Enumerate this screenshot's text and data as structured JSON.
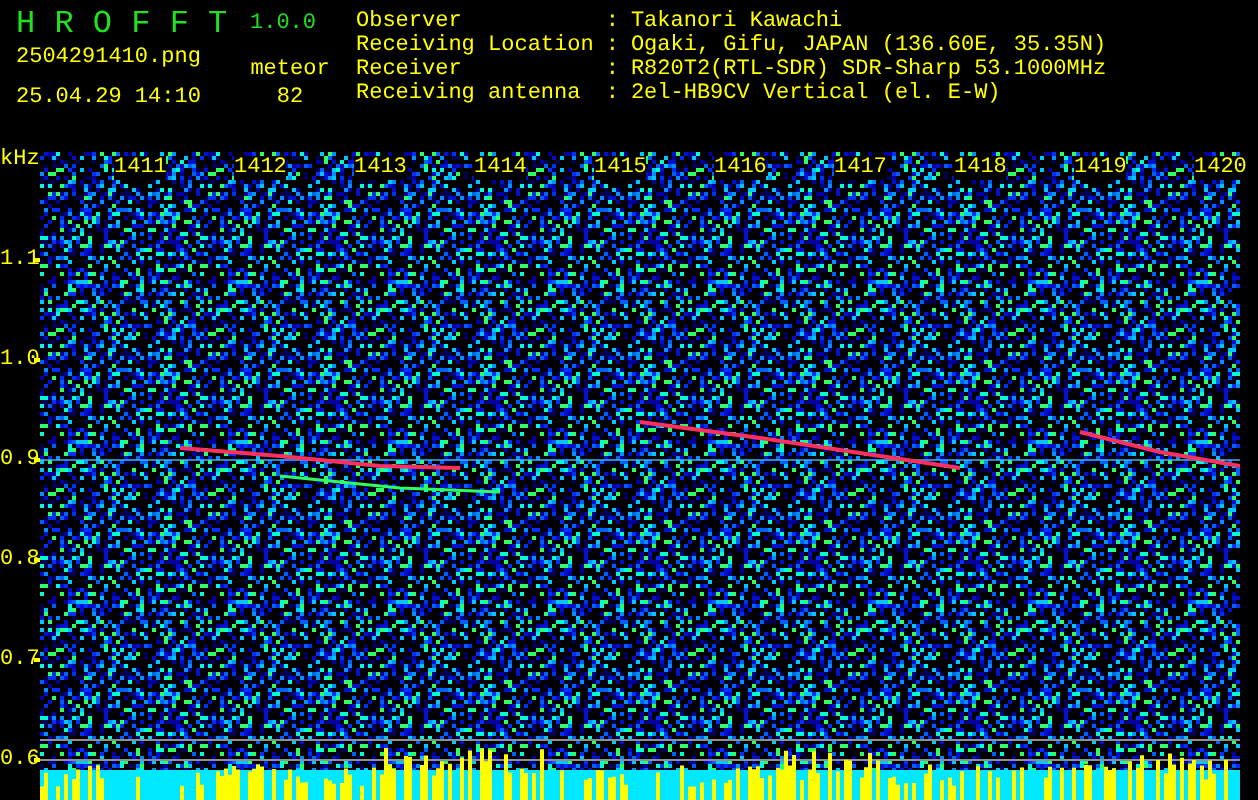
{
  "app": {
    "title": "H R O F F T",
    "version": "1.0.0"
  },
  "file": {
    "name": "2504291410.png",
    "datetime": "25.04.29 14:10"
  },
  "detection": {
    "label": "meteor",
    "count": "82"
  },
  "info": [
    {
      "label": "Observer",
      "separator": ":",
      "value": "Takanori Kawachi"
    },
    {
      "label": "Receiving Location",
      "separator": ":",
      "value": "Ogaki, Gifu, JAPAN (136.60E, 35.35N)"
    },
    {
      "label": "Receiver",
      "separator": ":",
      "value": "R820T2(RTL-SDR) SDR-Sharp 53.1000MHz"
    },
    {
      "label": "Receiving antenna",
      "separator": ":",
      "value": "2el-HB9CV Vertical (el. E-W)"
    }
  ],
  "plot": {
    "y_unit": "kHz",
    "x_labels": [
      "1411",
      "1412",
      "1413",
      "1414",
      "1415",
      "1416",
      "1417",
      "1418",
      "1419",
      "1420"
    ],
    "y_labels": [
      "1.1",
      "1.0",
      "0.9",
      "0.8",
      "0.7",
      "0.6"
    ]
  }
}
